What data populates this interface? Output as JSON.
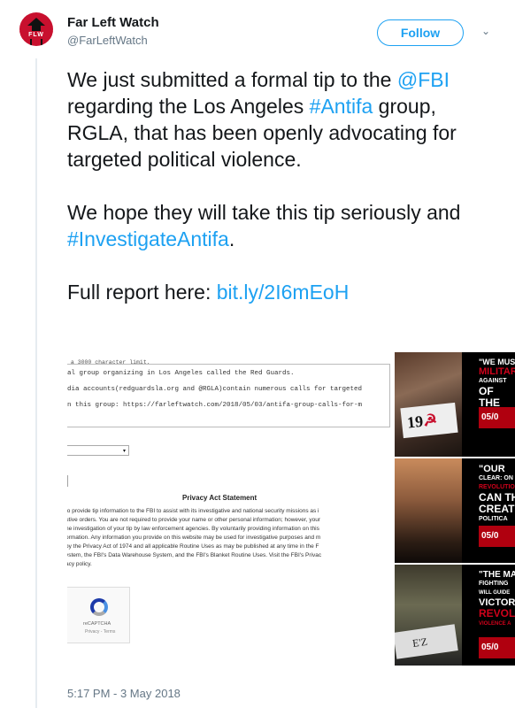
{
  "account": {
    "name": "Far Left Watch",
    "handle": "@FarLeftWatch",
    "avatar_text": "FLW"
  },
  "follow_label": "Follow",
  "tweet": {
    "p1_before": "We just submitted a formal tip to the ",
    "p1_mention": "@FBI",
    "p1_middle": " regarding the Los Angeles ",
    "p1_hashtag": "#Antifa",
    "p1_after": " group, RGLA, that has been openly advocating for targeted political violence.",
    "p2_before": "We hope they will take this tip seriously and ",
    "p2_hashtag": "#InvestigateAntifa",
    "p2_after": ".",
    "p3_before": "Full report here: ",
    "p3_link": "bit.ly/2I6mEoH"
  },
  "screenshot": {
    "limit_text": " a 3000 character limit.",
    "line1": "al group organizing in Los Angeles called the Red Guards.",
    "line2": "dia accounts(redguardsla.org and @RGLA)contain numerous calls for targeted",
    "line3": "n this group: https://farleftwatch.com/2018/05/03/antifa-group-calls-for-m",
    "select_arrow": "▾",
    "bracket": "]",
    "privacy_title": "Privacy Act Statement",
    "privacy_lines": [
      "to provide tip information to the FBI to assist with its investigative and national security missions as i",
      "utive orders. You are not required to provide your name or other personal information; however, your",
      "he investigation of your tip by law enforcement agencies. By voluntarily providing information on this",
      "ormation. Any information you provide on this website may be used for investigative purposes and m",
      " by the Privacy Act of 1974 and all applicable Routine Uses as may be published at any time in the F",
      "ystem, the FBI's Data Warehouse System, and the FBI's Blanket Routine Uses. Visit the FBI's Privac",
      "acy policy."
    ],
    "recaptcha_label": "reCAPTCHA",
    "recaptcha_terms": "Privacy - Terms"
  },
  "panels": [
    {
      "lines": [
        "\"WE MUS",
        "MILITAR",
        "AGAINST",
        "OF THE"
      ],
      "red_lines": [
        1
      ],
      "date": "05/0",
      "photo_text": "19"
    },
    {
      "lines": [
        "\"OUR",
        "CLEAR: ON",
        "REVOLUTION",
        "CAN TH",
        "CREAT",
        "POLITICA"
      ],
      "red_lines": [
        2
      ],
      "date": "05/0"
    },
    {
      "lines": [
        "\"THE MA",
        "FIGHTING",
        "WILL GUIDE",
        "VICTORY",
        "REVOLU",
        "VIOLENCE A"
      ],
      "red_lines": [
        4,
        5
      ],
      "date": "05/0",
      "photo_text": "E'Z"
    }
  ],
  "timestamp": "5:17 PM - 3 May 2018",
  "colors": {
    "link": "#1da1f2",
    "text": "#14171a",
    "muted": "#657786",
    "accent_red": "#c8102e"
  }
}
